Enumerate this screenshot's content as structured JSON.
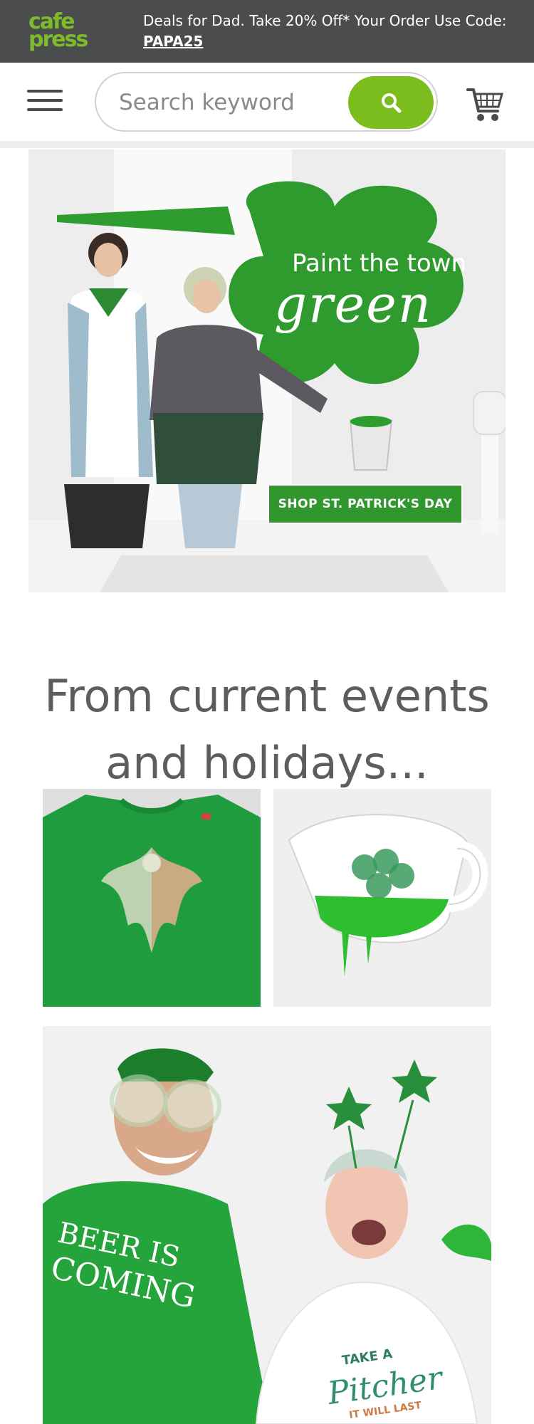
{
  "promo": {
    "logo_line1": "cafe",
    "logo_line2": "press",
    "message": "Deals for Dad. Take 20% Off* Your Order Use Code:",
    "code": "PAPA25"
  },
  "header": {
    "menu_icon": "hamburger-menu-icon",
    "search_placeholder": "Search keyword",
    "search_icon": "search-icon",
    "cart_icon": "shopping-cart-icon"
  },
  "hero": {
    "tagline_small": "Paint the town",
    "tagline_large": "green",
    "cta_label": "SHOP ST. PATRICK'S DAY"
  },
  "section": {
    "heading": "From current events and holidays..."
  },
  "products": {
    "shirt_text": "",
    "people_shirt_left_line1": "BEER IS",
    "people_shirt_left_line2": "COMING",
    "people_shirt_right_line1": "TAKE A",
    "people_shirt_right_line2": "Pitcher",
    "people_shirt_right_line3": "IT WILL LAST"
  },
  "colors": {
    "promo_bg": "#4a4c4e",
    "brand_green": "#7dbb2a",
    "search_green": "#7cbd1e",
    "cta_green": "#32962f",
    "shamrock_green": "#2f9b2f"
  }
}
